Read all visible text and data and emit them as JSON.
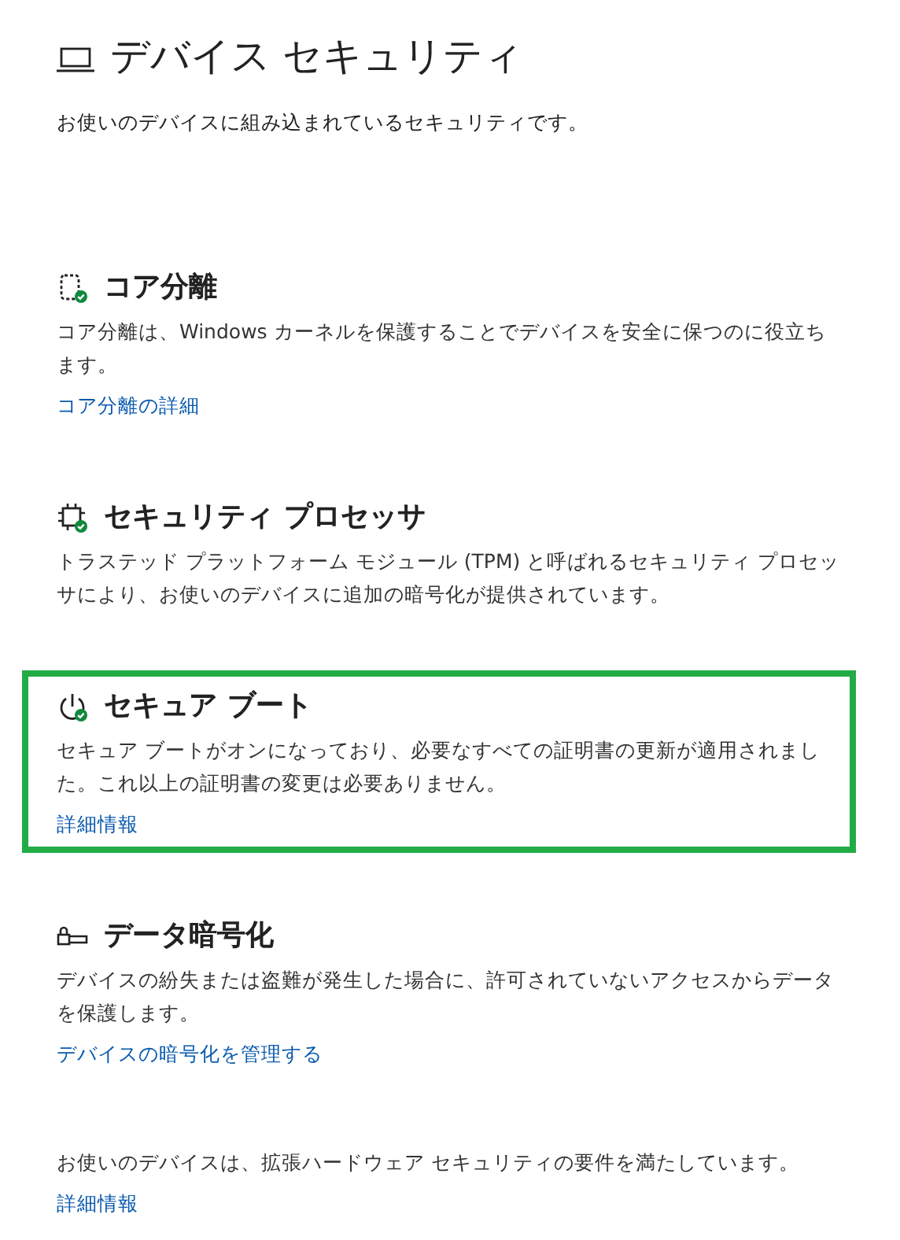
{
  "page": {
    "title": "デバイス セキュリティ",
    "subtitle": "お使いのデバイスに組み込まれているセキュリティです。"
  },
  "sections": [
    {
      "title": "コア分離",
      "description": "コア分離は、Windows カーネルを保護することでデバイスを安全に保つのに役立ちます。",
      "link": "コア分離の詳細",
      "highlighted": false
    },
    {
      "title": "セキュリティ プロセッサ",
      "description": "トラステッド プラットフォーム モジュール (TPM) と呼ばれるセキュリティ プロセッサにより、お使いのデバイスに追加の暗号化が提供されています。",
      "highlighted": false
    },
    {
      "title": "セキュア ブート",
      "description": "セキュア ブートがオンになっており、必要なすべての証明書の更新が適用されました。これ以上の証明書の変更は必要ありません。",
      "link": "詳細情報",
      "highlighted": true
    },
    {
      "title": "データ暗号化",
      "description": "デバイスの紛失または盗難が発生した場合に、許可されていないアクセスからデータを保護します。",
      "link": "デバイスの暗号化を管理する",
      "highlighted": false
    }
  ],
  "footer": {
    "text": "お使いのデバイスは、拡張ハードウェア セキュリティの要件を満たしています。",
    "link": "詳細情報"
  }
}
